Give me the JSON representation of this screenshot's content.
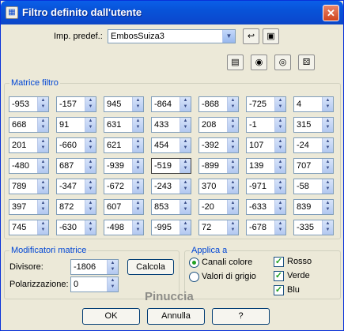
{
  "window": {
    "title": "Filtro definito dall'utente",
    "close": "✕"
  },
  "preset": {
    "label": "Imp. predef.:",
    "value": "EmbosSuiza3"
  },
  "matrix": {
    "title": "Matrice filtro",
    "rows": [
      [
        "-953",
        "-157",
        "945",
        "-864",
        "-868",
        "-725",
        "4"
      ],
      [
        "668",
        "91",
        "631",
        "433",
        "208",
        "-1",
        "315"
      ],
      [
        "201",
        "-660",
        "621",
        "454",
        "-392",
        "107",
        "-24"
      ],
      [
        "-480",
        "687",
        "-939",
        "-519",
        "-899",
        "139",
        "707"
      ],
      [
        "789",
        "-347",
        "-672",
        "-243",
        "370",
        "-971",
        "-58"
      ],
      [
        "397",
        "872",
        "607",
        "853",
        "-20",
        "-633",
        "839"
      ],
      [
        "745",
        "-630",
        "-498",
        "-995",
        "72",
        "-678",
        "-335"
      ]
    ]
  },
  "modifiers": {
    "title": "Modificatori matrice",
    "divisor_label": "Divisore:",
    "divisor_value": "-1806",
    "bias_label": "Polarizzazione:",
    "bias_value": "0",
    "calc_button": "Calcola"
  },
  "apply": {
    "title": "Applica a",
    "radio_channels": "Canali colore",
    "radio_gray": "Valori di grigio",
    "check_red": "Rosso",
    "check_green": "Verde",
    "check_blue": "Blu"
  },
  "buttons": {
    "ok": "OK",
    "cancel": "Annulla",
    "help": "?"
  },
  "watermark": "Pinuccia"
}
